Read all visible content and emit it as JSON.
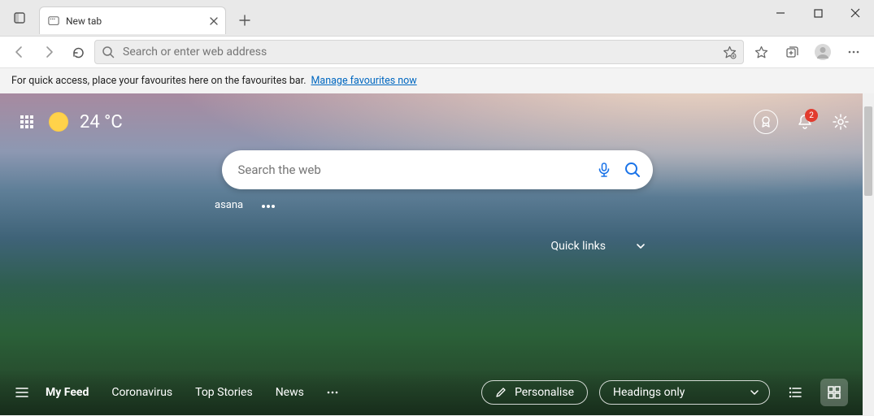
{
  "titlebar": {
    "tab_title": "New tab"
  },
  "toolbar": {
    "address_placeholder": "Search or enter web address"
  },
  "favbar": {
    "message": "For quick access, place your favourites here on the favourites bar.",
    "link": "Manage favourites now"
  },
  "ntp": {
    "temperature": "24 °C",
    "search_placeholder": "Search the web",
    "quick_link_items": [
      "asana"
    ],
    "quick_links_label": "Quick links",
    "notification_count": "2"
  },
  "feed": {
    "tabs": [
      "My Feed",
      "Coronavirus",
      "Top Stories",
      "News"
    ],
    "active_tab": "My Feed",
    "personalise": "Personalise",
    "layout_label": "Headings only"
  }
}
